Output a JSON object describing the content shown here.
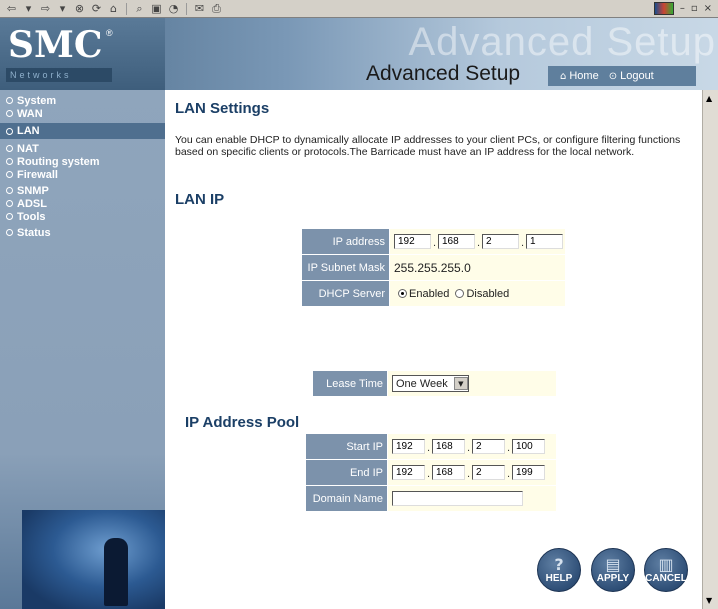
{
  "browser": {
    "toolbar_icons": [
      "back-icon",
      "forward-icon",
      "stop-icon",
      "refresh-icon",
      "home-icon",
      "search-icon",
      "favorites-icon",
      "history-icon",
      "mail-icon",
      "print-icon"
    ],
    "window_controls": [
      "–",
      "▫",
      "×"
    ]
  },
  "header": {
    "logo_text": "SMC",
    "logo_reg": "®",
    "logo_sub": "Networks",
    "background_title": "Advanced Setup",
    "page_title": "Advanced Setup",
    "home_label": "Home",
    "logout_label": "Logout"
  },
  "sidebar": {
    "items": [
      {
        "label": "System",
        "active": false
      },
      {
        "label": "WAN",
        "active": false
      },
      {
        "label": "LAN",
        "active": true
      },
      {
        "label": "NAT",
        "active": false
      },
      {
        "label": "Routing system",
        "active": false
      },
      {
        "label": "Firewall",
        "active": false
      },
      {
        "label": "SNMP",
        "active": false
      },
      {
        "label": "ADSL",
        "active": false
      },
      {
        "label": "Tools",
        "active": false
      },
      {
        "label": "Status",
        "active": false
      }
    ]
  },
  "main": {
    "title": "LAN Settings",
    "intro": "You can enable DHCP to dynamically allocate IP addresses to your client PCs, or configure filtering functions based on specific clients or protocols.The Barricade must have an IP address for the local network.",
    "lan_ip_heading": "LAN IP",
    "lan_ip": {
      "ip_label": "IP address",
      "ip": [
        "192",
        "168",
        "2",
        "1"
      ],
      "mask_label": "IP Subnet Mask",
      "mask_value": "255.255.255.0",
      "dhcp_label": "DHCP Server",
      "enabled_label": "Enabled",
      "disabled_label": "Disabled",
      "dhcp_enabled": true
    },
    "lease": {
      "label": "Lease Time",
      "value": "One Week"
    },
    "pool_heading": "IP Address Pool",
    "pool": {
      "start_label": "Start IP",
      "start": [
        "192",
        "168",
        "2",
        "100"
      ],
      "end_label": "End IP",
      "end": [
        "192",
        "168",
        "2",
        "199"
      ],
      "domain_label": "Domain Name",
      "domain_value": ""
    },
    "buttons": {
      "help": "HELP",
      "apply": "APPLY",
      "cancel": "CANCEL"
    }
  }
}
